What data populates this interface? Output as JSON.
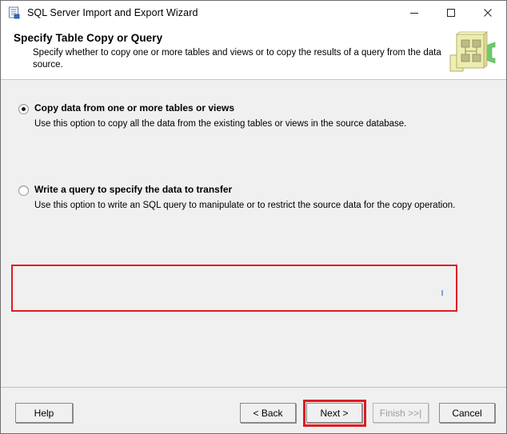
{
  "window": {
    "title": "SQL Server Import and Export Wizard",
    "icon": "wizard-document-icon",
    "controls": {
      "minimize": "minimize-icon",
      "maximize": "maximize-icon",
      "close": "close-icon"
    }
  },
  "header": {
    "title": "Specify Table Copy or Query",
    "subtitle": "Specify whether to copy one or more tables and views or to copy the results of a query from the data source.",
    "banner_icon": "flowchart-green-arrow-icon"
  },
  "options": [
    {
      "label": "Copy data from one or more tables or views",
      "description": "Use this option to copy all the data from the existing tables or views in the source database.",
      "selected": true
    },
    {
      "label": "Write a query to specify the data to transfer",
      "description": "Use this option to write an SQL query to manipulate or to restrict the source data for the copy operation.",
      "selected": false
    }
  ],
  "footer": {
    "help_label": "Help",
    "back_label": "< Back",
    "next_label": "Next >",
    "finish_label": "Finish >>|",
    "finish_disabled": true,
    "cancel_label": "Cancel"
  },
  "annotations": {
    "highlight_color": "#e01b22",
    "highlighted_option_index": 1,
    "highlighted_button": "Next >"
  }
}
